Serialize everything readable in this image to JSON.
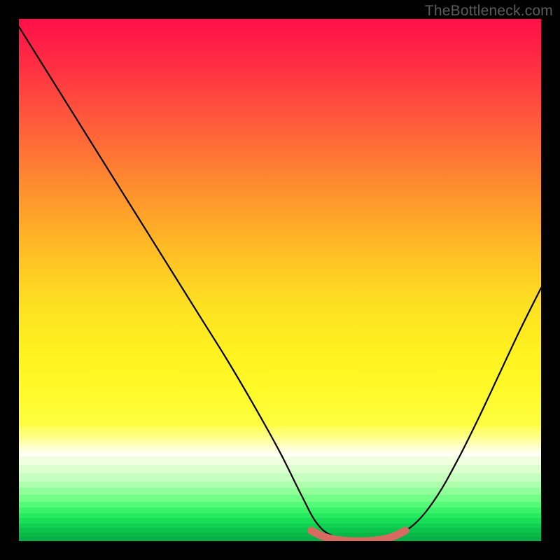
{
  "watermark": "TheBottleneck.com",
  "chart_data": {
    "type": "line",
    "title": "",
    "xlabel": "",
    "ylabel": "",
    "xlim": [
      0,
      1
    ],
    "ylim": [
      0,
      1
    ],
    "series": [
      {
        "name": "bottleneck-curve",
        "x": [
          0.0,
          0.05,
          0.1,
          0.15,
          0.2,
          0.25,
          0.3,
          0.35,
          0.4,
          0.45,
          0.5,
          0.54,
          0.57,
          0.6,
          0.64,
          0.68,
          0.72,
          0.76,
          0.8,
          0.84,
          0.88,
          0.92,
          0.96,
          1.0
        ],
        "values": [
          0.985,
          0.905,
          0.825,
          0.745,
          0.665,
          0.585,
          0.505,
          0.425,
          0.345,
          0.26,
          0.17,
          0.09,
          0.035,
          0.01,
          0.0,
          0.0,
          0.01,
          0.035,
          0.085,
          0.155,
          0.235,
          0.32,
          0.405,
          0.485
        ]
      },
      {
        "name": "valley-marker",
        "x": [
          0.56,
          0.58,
          0.6,
          0.62,
          0.64,
          0.66,
          0.68,
          0.7,
          0.72,
          0.74
        ],
        "values": [
          0.02,
          0.01,
          0.004,
          0.001,
          0.0,
          0.0,
          0.001,
          0.004,
          0.01,
          0.02
        ]
      }
    ],
    "background_gradient": {
      "top": "#ff1048",
      "mid1": "#ffb825",
      "mid2": "#fffd42",
      "band": "#ffffff",
      "stripes": [
        "#f0ffe0",
        "#dcffd0",
        "#c6ffbf",
        "#adffad",
        "#90ff99",
        "#72ff88",
        "#55fb78",
        "#3af36a",
        "#26ea5f",
        "#16de56",
        "#0fd050",
        "#0cc34b",
        "#0ab848",
        "#09b047"
      ]
    }
  }
}
